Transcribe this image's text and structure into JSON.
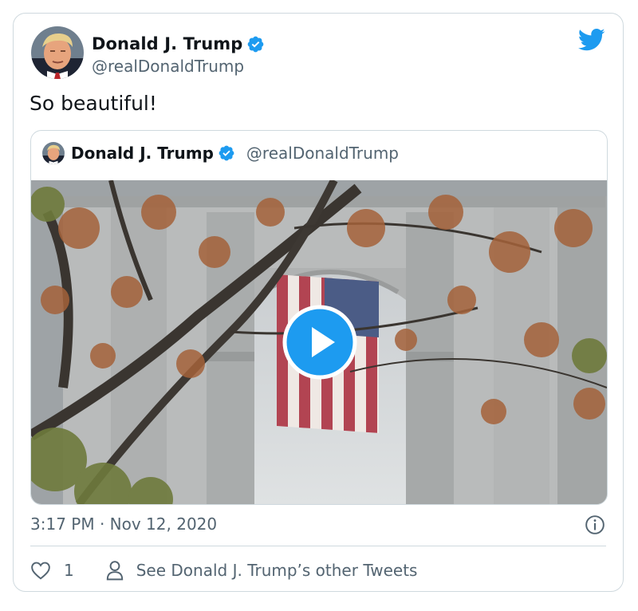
{
  "tweet": {
    "author": {
      "display_name": "Donald J. Trump",
      "handle": "@realDonaldTrump",
      "verified": true
    },
    "text": "So beautiful!",
    "timestamp": "3:17 PM · Nov 12, 2020",
    "likes": "1",
    "other_tweets_label": "See Donald J. Trump’s other Tweets"
  },
  "quoted_tweet": {
    "display_name": "Donald J. Trump",
    "handle": "@realDonaldTrump",
    "verified": true,
    "media": {
      "type": "video",
      "icon": "play-icon"
    }
  },
  "icons": {
    "brand": "twitter-bird-icon",
    "verified": "verified-badge-icon",
    "info": "info-icon",
    "like": "heart-icon",
    "profile": "person-icon"
  },
  "colors": {
    "brand": "#1d9bf0",
    "text": "#0f1419",
    "secondary": "#536471",
    "border": "#cfd9de"
  }
}
